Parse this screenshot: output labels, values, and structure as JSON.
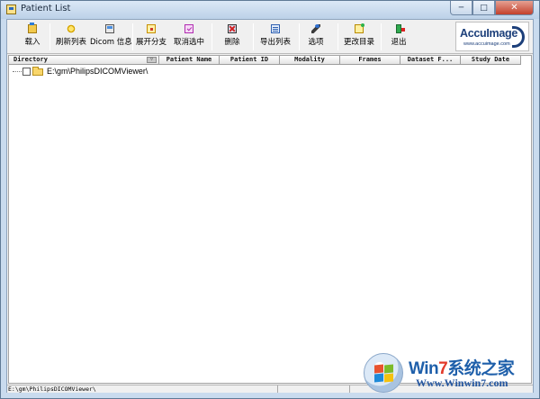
{
  "window": {
    "title": "Patient List",
    "controls": {
      "minimize": "─",
      "maximize": "□",
      "close": "✕"
    }
  },
  "toolbar": {
    "buttons": [
      {
        "label": "载入",
        "icon": "folder-open-icon"
      },
      {
        "label": "刷新列表",
        "icon": "star-refresh-icon"
      },
      {
        "label": "Dicom 信息",
        "icon": "monitor-info-icon"
      },
      {
        "label": "展开分支",
        "icon": "expand-tree-icon"
      },
      {
        "label": "取消选中",
        "icon": "checkbox-uncheck-icon"
      },
      {
        "label": "删除",
        "icon": "delete-icon"
      },
      {
        "label": "导出列表",
        "icon": "export-list-icon"
      },
      {
        "label": "选项",
        "icon": "options-icon"
      },
      {
        "label": "更改目录",
        "icon": "change-directory-icon"
      },
      {
        "label": "退出",
        "icon": "exit-door-icon"
      }
    ],
    "logo": {
      "text": "AccuImage",
      "subtext": "www.accuimage.com"
    }
  },
  "grid": {
    "columns": [
      "Directory",
      "Patient Name",
      "Patient ID",
      "Modality",
      "Frames",
      "Dataset F...",
      "Study Date"
    ],
    "dropdown_glyph": "▽",
    "rows": [
      {
        "directory": "E:\\gm\\PhilipsDICOMViewer\\",
        "checked": false
      }
    ]
  },
  "statusbar": {
    "path": "E:\\gm\\PhilipsDICOMViewer\\"
  },
  "watermark": {
    "text_prefix": "Win",
    "text_seven": "7",
    "text_suffix": "系统之家",
    "url": "Www.Winwin7.com",
    "colors": {
      "blue": "#1e5faa",
      "red": "#e23a2b"
    }
  }
}
